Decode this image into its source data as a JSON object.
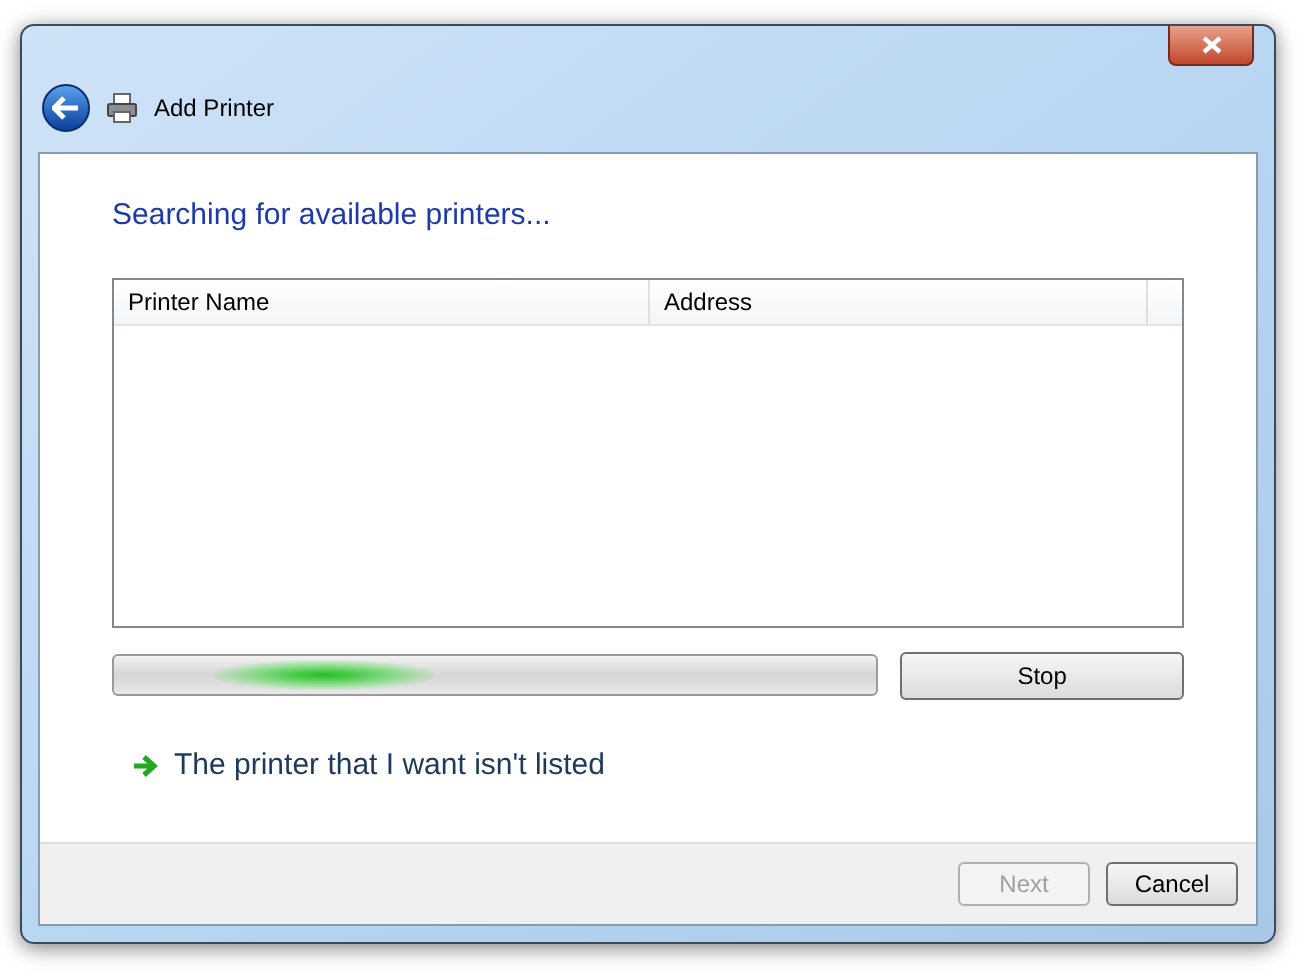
{
  "window": {
    "title": "Add Printer"
  },
  "heading": "Searching for available printers...",
  "table": {
    "columns": [
      "Printer Name",
      "Address"
    ]
  },
  "progress": {
    "kind": "marquee"
  },
  "stop_button": {
    "label": "Stop",
    "disabled": false
  },
  "link": "The printer that I want isn't listed",
  "buttons": [
    {
      "label": "Next",
      "disabled": true
    },
    {
      "label": "Cancel",
      "disabled": false
    }
  ]
}
